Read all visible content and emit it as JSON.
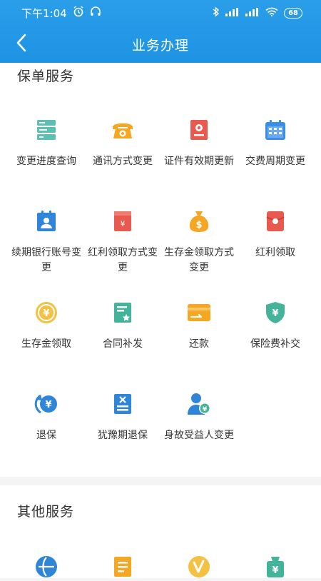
{
  "status_bar": {
    "time": "下午1:04",
    "battery": "68"
  },
  "nav": {
    "title": "业务办理"
  },
  "policy_services": {
    "title": "保单服务",
    "items": [
      {
        "label": "变更进度查询",
        "icon": "progress-list-icon"
      },
      {
        "label": "通讯方式变更",
        "icon": "telephone-icon"
      },
      {
        "label": "证件有效期更新",
        "icon": "id-document-icon"
      },
      {
        "label": "交费周期变更",
        "icon": "calendar-icon"
      },
      {
        "label": "续期银行账号变更",
        "icon": "bank-account-card-icon"
      },
      {
        "label": "红利领取方式变更",
        "icon": "dividend-method-icon"
      },
      {
        "label": "生存金领取方式变更",
        "icon": "money-bag-icon"
      },
      {
        "label": "红利领取",
        "icon": "red-envelope-icon"
      },
      {
        "label": "生存金领取",
        "icon": "yuan-coin-icon"
      },
      {
        "label": "合同补发",
        "icon": "contract-reissue-icon"
      },
      {
        "label": "还款",
        "icon": "repayment-card-icon"
      },
      {
        "label": "保险费补交",
        "icon": "shield-yuan-icon"
      },
      {
        "label": "退保",
        "icon": "surrender-refund-icon"
      },
      {
        "label": "犹豫期退保",
        "icon": "cooling-off-surrender-icon"
      },
      {
        "label": "身故受益人变更",
        "icon": "beneficiary-change-icon"
      }
    ]
  },
  "other_services": {
    "title": "其他服务",
    "items": [
      {
        "icon": "globe-icon"
      },
      {
        "icon": "document-icon"
      },
      {
        "icon": "vip-coin-icon"
      },
      {
        "icon": "yuan-bag-icon"
      }
    ]
  }
}
